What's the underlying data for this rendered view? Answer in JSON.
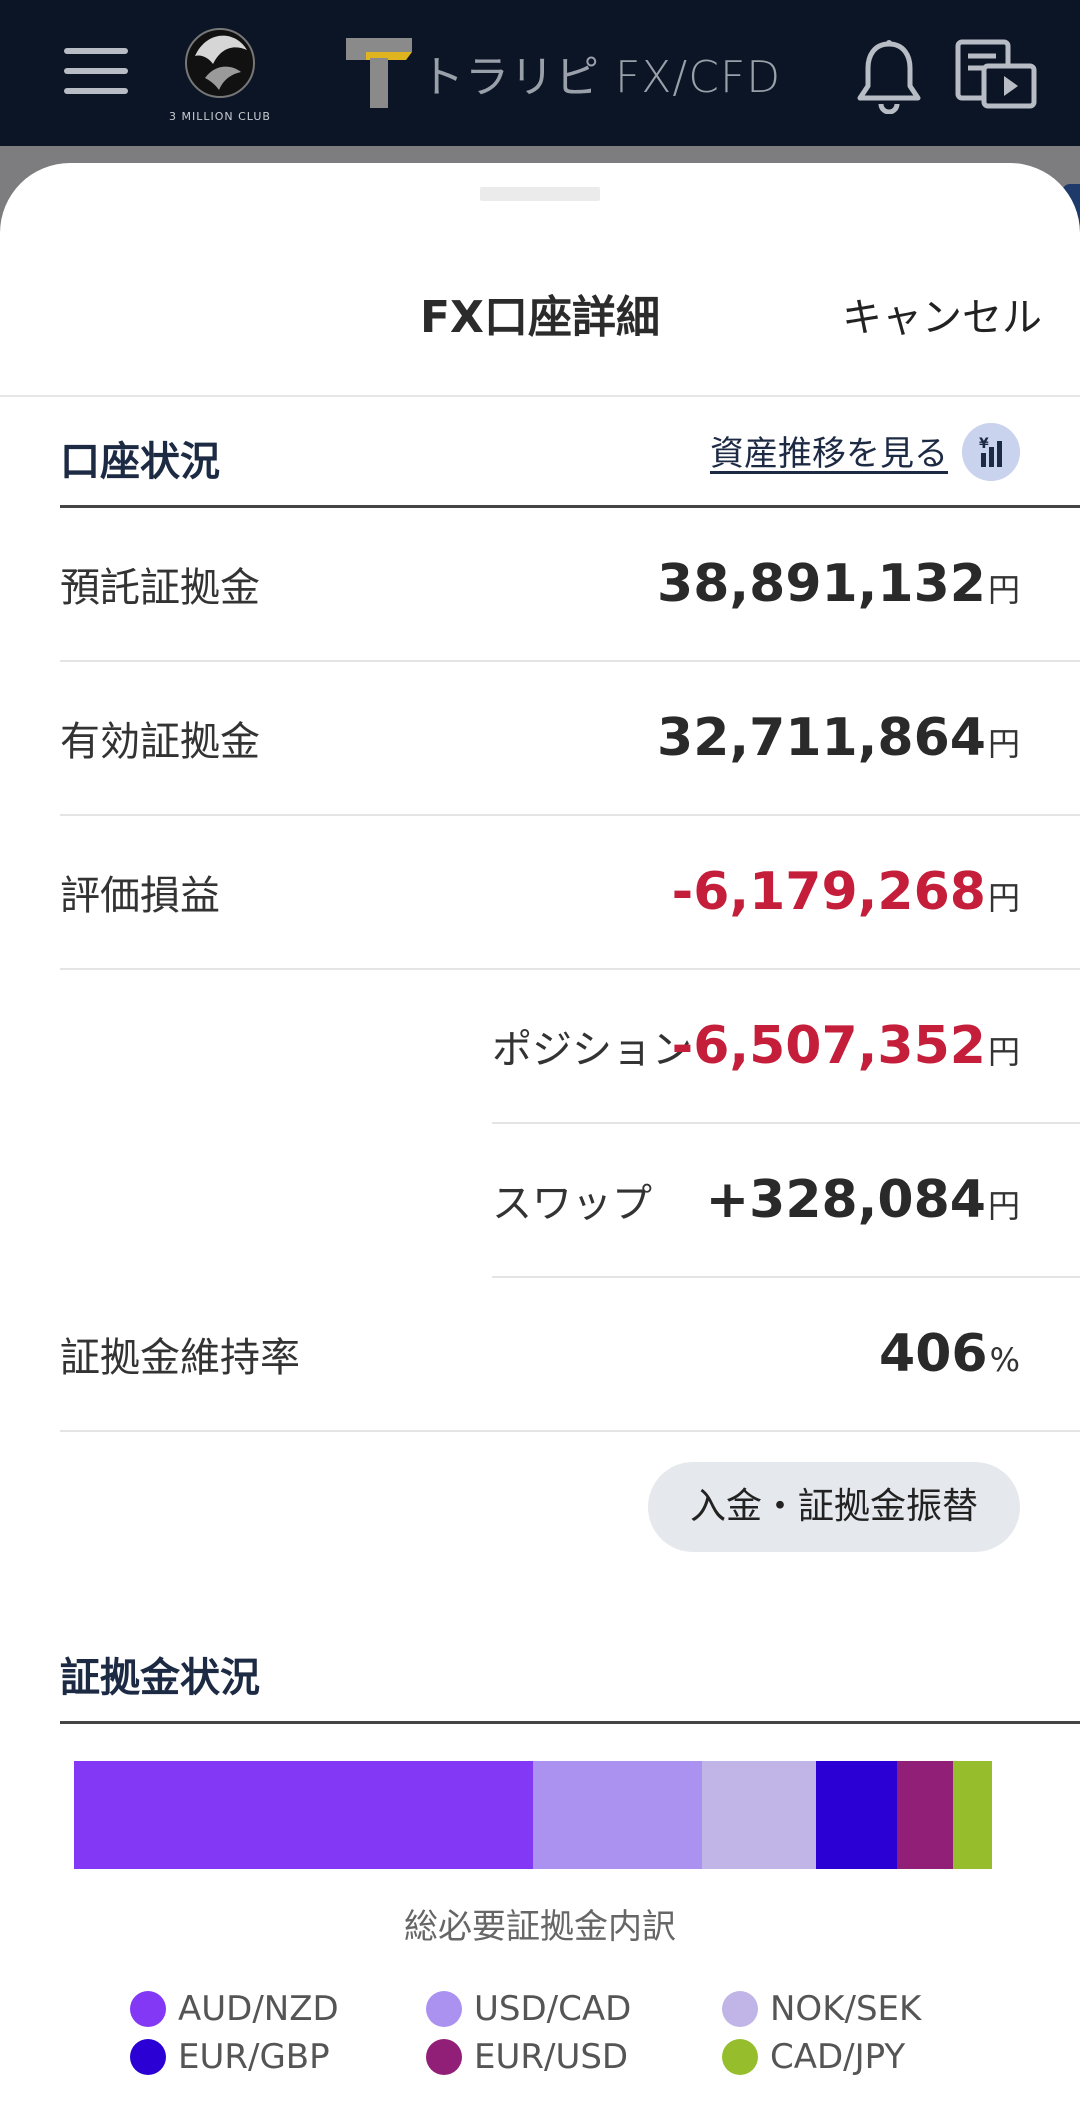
{
  "header": {
    "club_logo_text": "3 MILLION CLUB",
    "brand_name": "トラリピ FX/CFD"
  },
  "sheet": {
    "title": "FX口座詳細",
    "cancel_label": "キャンセル"
  },
  "account": {
    "section_title": "口座状況",
    "history_link": "資産推移を見る",
    "rows": [
      {
        "label": "預託証拠金",
        "value": "38,891,132",
        "unit": "円",
        "negative": false
      },
      {
        "label": "有効証拠金",
        "value": "32,711,864",
        "unit": "円",
        "negative": false
      },
      {
        "label": "評価損益",
        "value": "-6,179,268",
        "unit": "円",
        "negative": true
      },
      {
        "label": "ポジション",
        "value": "-6,507,352",
        "unit": "円",
        "negative": true
      },
      {
        "label": "スワップ",
        "value": "+328,084",
        "unit": "円",
        "negative": false
      },
      {
        "label": "証拠金維持率",
        "value": "406",
        "unit": "%",
        "negative": false
      }
    ],
    "deposit_button": "入金・証拠金振替"
  },
  "margin": {
    "section_title": "証拠金状況",
    "caption": "総必要証拠金内訳"
  },
  "chart_data": {
    "type": "bar",
    "stacked": true,
    "title": "総必要証拠金内訳",
    "unit": "share of total required margin (%)",
    "series": [
      {
        "name": "AUD/NZD",
        "share": 50.0,
        "color": "#8338f5"
      },
      {
        "name": "USD/CAD",
        "share": 18.4,
        "color": "#ab92f0"
      },
      {
        "name": "NOK/SEK",
        "share": 12.4,
        "color": "#c0b5e6"
      },
      {
        "name": "EUR/GBP",
        "share": 8.9,
        "color": "#2a00d4"
      },
      {
        "name": "EUR/USD",
        "share": 6.0,
        "color": "#921f77"
      },
      {
        "name": "CAD/JPY",
        "share": 4.3,
        "color": "#96be2c"
      }
    ]
  }
}
